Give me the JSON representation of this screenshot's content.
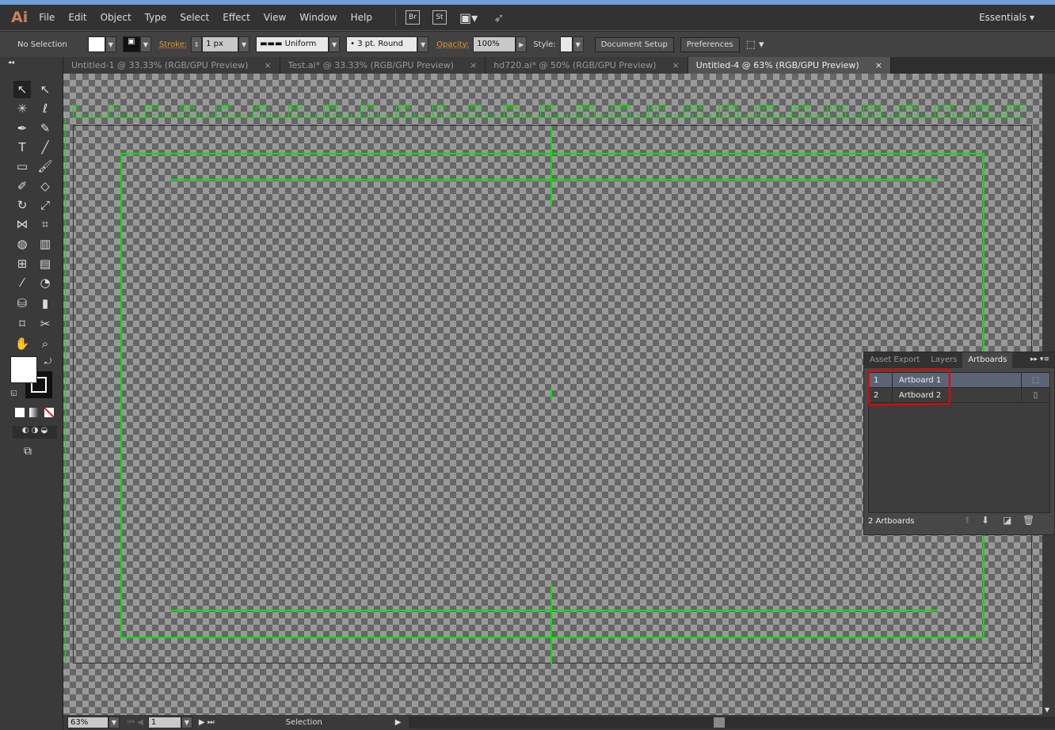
{
  "app": {
    "logo": "Ai",
    "menus": [
      "File",
      "Edit",
      "Object",
      "Type",
      "Select",
      "Effect",
      "View",
      "Window",
      "Help"
    ],
    "bridge": "Br",
    "stock": "St",
    "workspace": "Essentials"
  },
  "control": {
    "selection": "No Selection",
    "stroke_label": "Stroke:",
    "stroke_value": "1 px",
    "profile": "Uniform",
    "brush": "3 pt. Round",
    "opacity_label": "Opacity:",
    "opacity_value": "100%",
    "style_label": "Style:",
    "document_setup": "Document Setup",
    "preferences": "Preferences"
  },
  "tabs": [
    {
      "label": "Untitled-1 @ 33.33% (RGB/GPU Preview)"
    },
    {
      "label": "Test.ai* @ 33.33% (RGB/GPU Preview)"
    },
    {
      "label": "hd720.ai* @ 50% (RGB/GPU Preview)"
    },
    {
      "label": "Untitled-4 @ 63% (RGB/GPU Preview)",
      "active": true
    }
  ],
  "ruler_labels": [
    "0",
    "72",
    "144",
    "216",
    "288",
    "360",
    "432",
    "504",
    "576",
    "648",
    "720",
    "792",
    "864",
    "936",
    "1008",
    "1080",
    "1152",
    "1224",
    "1296",
    "1368",
    "1440",
    "1512",
    "1584",
    "1656",
    "1728",
    "1800",
    "1872"
  ],
  "colors": {
    "guide": "#00e000",
    "accent": "#e59a2e",
    "annotation": "#e00000"
  },
  "panel": {
    "tabs": [
      "Asset Export",
      "Layers",
      "Artboards"
    ],
    "active_tab": "Artboards",
    "artboards": [
      {
        "num": "1",
        "name": "Artboard 1"
      },
      {
        "num": "2",
        "name": "Artboard 2"
      }
    ],
    "count": "2 Artboards"
  },
  "status": {
    "zoom": "63%",
    "artboard": "1",
    "tool": "Selection"
  }
}
